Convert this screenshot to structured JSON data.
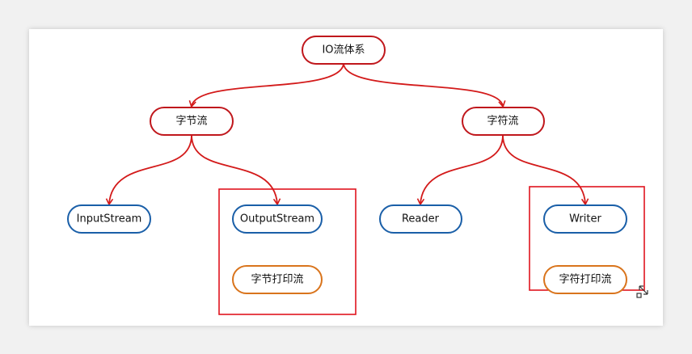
{
  "nodes": {
    "root": "IO流体系",
    "byte_stream": "字节流",
    "char_stream": "字符流",
    "input_stream": "InputStream",
    "output_stream": "OutputStream",
    "byte_print_stream": "字节打印流",
    "reader": "Reader",
    "writer": "Writer",
    "char_print_stream": "字符打印流"
  },
  "colors": {
    "arrow": "#d31a1a",
    "red_border": "#c0171c",
    "blue_border": "#1a5fa8",
    "orange_border": "#d9741c",
    "highlight_box": "#e0141e"
  },
  "icons": [
    "resize-cursor-icon"
  ]
}
